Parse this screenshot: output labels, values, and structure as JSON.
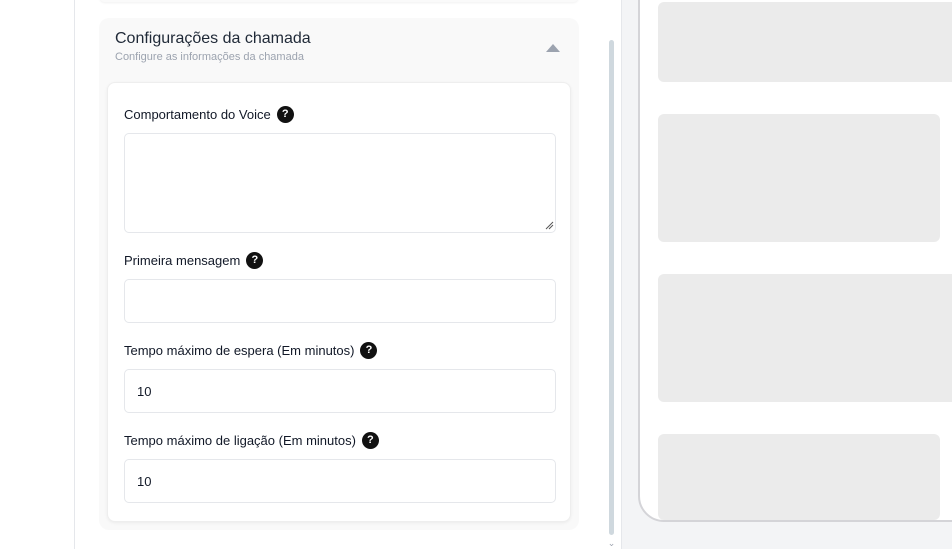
{
  "section": {
    "title": "Configurações da chamada",
    "subtitle": "Configure as informações da chamada"
  },
  "fields": {
    "behavior": {
      "label": "Comportamento do Voice",
      "value": "",
      "placeholder": ""
    },
    "first_message": {
      "label": "Primeira mensagem",
      "value": "",
      "placeholder": ""
    },
    "max_wait": {
      "label": "Tempo máximo de espera (Em minutos)",
      "value": "10"
    },
    "max_call": {
      "label": "Tempo máximo de ligação (Em minutos)",
      "value": "10"
    }
  },
  "icons": {
    "help": "question-circle-icon",
    "collapse": "triangle-up-icon"
  },
  "colors": {
    "help_icon_bg": "#111111",
    "skeleton": "#ebebeb",
    "scrollbar": "#cfd8de"
  }
}
